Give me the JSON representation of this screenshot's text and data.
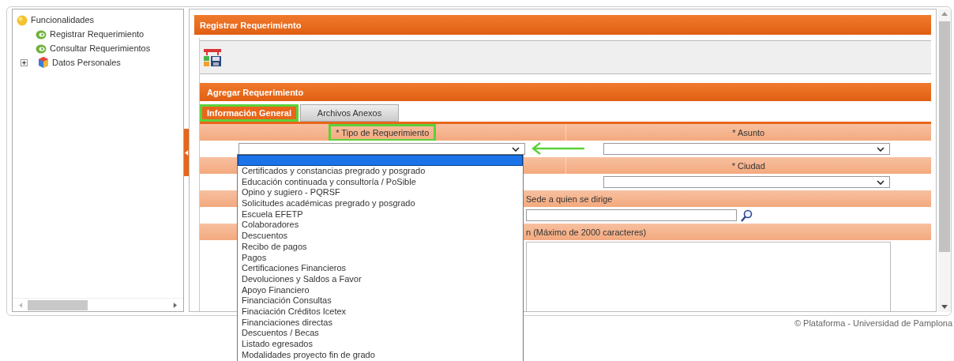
{
  "sidebar": {
    "root": {
      "label": "Funcionalidades",
      "children": [
        {
          "label": "Registrar Requerimiento",
          "kind": "link"
        },
        {
          "label": "Consultar Requerimientos",
          "kind": "link"
        },
        {
          "label": "Datos Personales",
          "kind": "folder",
          "expanded": false
        }
      ]
    }
  },
  "main": {
    "title": "Registrar Requerimiento",
    "section_title": "Agregar Requerimiento",
    "tabs": [
      {
        "label": "Información General",
        "selected": true,
        "highlighted": true
      },
      {
        "label": "Archivos Anexos",
        "selected": false,
        "highlighted": false
      }
    ],
    "form": {
      "rows": [
        {
          "kind": "pair",
          "left": {
            "label": "* Tipo de Requerimiento",
            "highlighted": true,
            "arrow": true
          },
          "right": {
            "label": "* Asunto",
            "highlighted": false
          }
        },
        {
          "kind": "pair",
          "right": {
            "label": "* Ciudad",
            "highlighted": false
          }
        },
        {
          "kind": "search",
          "label": "Sede a quien se dirige"
        },
        {
          "kind": "textarea",
          "label": "n (Máximo de 2000 caracteres)"
        }
      ]
    },
    "dropdown": {
      "blank_option_selected": true,
      "options": [
        "Certificados y constancias pregrado y posgrado",
        "Educación continuada y consultoría / PoSible",
        "Opino y sugiero - PQRSF",
        "Solicitudes académicas pregrado y posgrado",
        "Escuela EFETP",
        "Colaboradores",
        "Descuentos",
        "Recibo de pagos",
        "Pagos",
        "Certificaciones Financieros",
        "Devoluciones y Saldos a Favor",
        "Apoyo Financiero",
        "Financiación Consultas",
        "Finaciación Créditos Icetex",
        "Financiaciones directas",
        "Descuentos / Becas",
        "Listado egresados",
        "Modalidades proyecto fin de grado"
      ]
    }
  },
  "footer": "© Plataforma - Universidad de Pamplona"
}
